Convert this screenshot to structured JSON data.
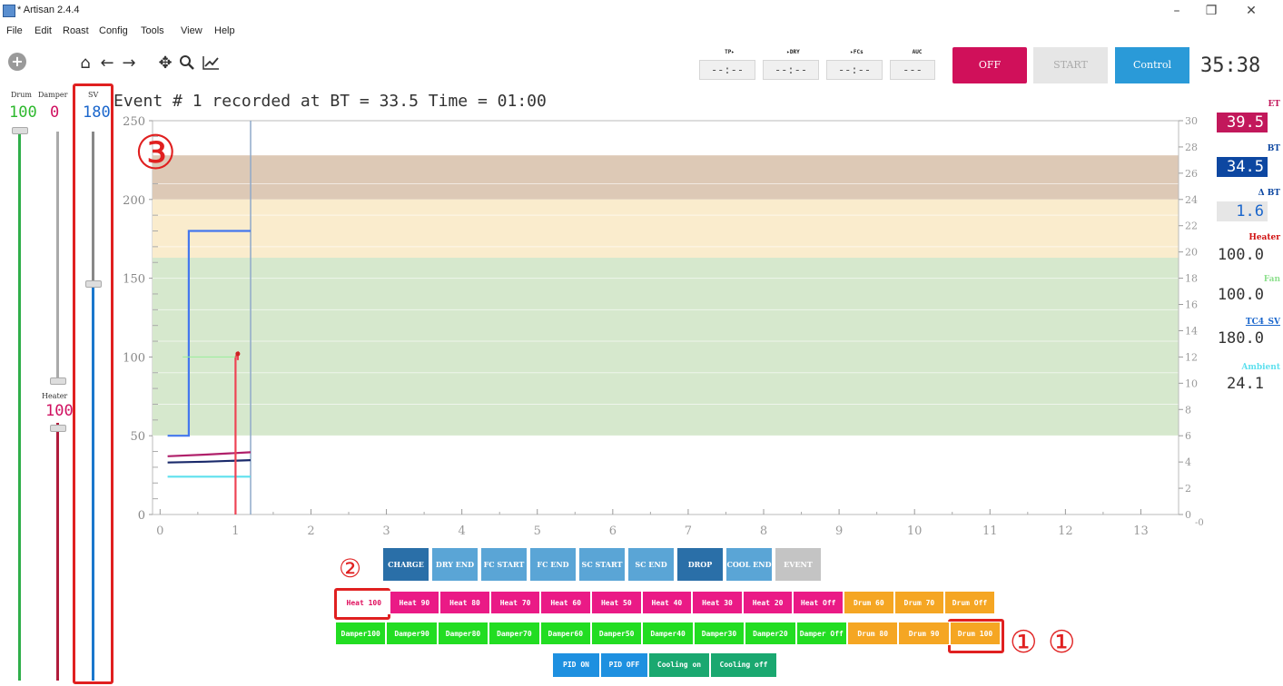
{
  "window": {
    "title": "* Artisan 2.4.4",
    "minimize": "–",
    "maximize": "❐",
    "close": "✕"
  },
  "menu": [
    "File",
    "Edit",
    "Roast",
    "Config",
    "Tools",
    "View",
    "Help"
  ],
  "toolbar": {
    "lcd_labels": [
      "TP▸",
      "▸DRY",
      "▸FCs",
      "AUC"
    ],
    "lcd_values": [
      "--:--",
      "--:--",
      "--:--",
      "---"
    ],
    "off_label": "OFF",
    "start_label": "START",
    "control_label": "Control",
    "timer": "35:38"
  },
  "sliders": {
    "drum": {
      "label": "Drum",
      "value": "100"
    },
    "damper": {
      "label": "Damper",
      "value": "0"
    },
    "sv": {
      "label": "SV",
      "value": "180"
    },
    "heater": {
      "label": "Heater",
      "value": "100"
    }
  },
  "event_message": "Event # 1 recorded at BT = 33.5  Time = 01:00",
  "readouts": {
    "et": {
      "label": "ET",
      "value": "39.5",
      "color": "#c2185b"
    },
    "bt": {
      "label": "BT",
      "value": "34.5",
      "color": "#0d47a1"
    },
    "delta_bt": {
      "label": "Δ BT",
      "value": "1.6"
    },
    "heater": {
      "label": "Heater",
      "value": "100.0"
    },
    "fan": {
      "label": "Fan",
      "value": "100.0"
    },
    "tc4_sv": {
      "label": "TC4_SV",
      "value": "180.0"
    },
    "ambient": {
      "label": "Ambient",
      "value": "24.1"
    }
  },
  "chart_data": {
    "type": "line",
    "xlabel": "",
    "ylabel": "",
    "xlim": [
      -0.1,
      13.5
    ],
    "ylim": [
      0,
      250
    ],
    "x_ticks": [
      "0",
      "1",
      "2",
      "3",
      "4",
      "5",
      "6",
      "7",
      "8",
      "9",
      "10",
      "11",
      "12",
      "13"
    ],
    "y_ticks": [
      "0",
      "50",
      "100",
      "150",
      "200",
      "250"
    ],
    "y2lim": [
      0,
      30
    ],
    "y2_ticks": [
      "0",
      "2",
      "4",
      "6",
      "8",
      "10",
      "12",
      "14",
      "16",
      "18",
      "20",
      "22",
      "24",
      "26",
      "28",
      "30"
    ],
    "y2_extra_tick": "-0",
    "bands": [
      {
        "from": 228,
        "to": 200,
        "color": "#ddc9b6"
      },
      {
        "from": 200,
        "to": 163,
        "color": "#faeccd"
      },
      {
        "from": 163,
        "to": 50,
        "color": "#d6e8cd"
      }
    ],
    "event_line_x": 1.2,
    "series": [
      {
        "name": "SV",
        "color": "#4477ee",
        "x": [
          0.1,
          0.38,
          0.38,
          1.2
        ],
        "y": [
          50,
          50,
          180,
          180
        ]
      },
      {
        "name": "ET",
        "color": "#b0206a",
        "x": [
          0.1,
          0.6,
          1.2
        ],
        "y": [
          37,
          38,
          39.5
        ]
      },
      {
        "name": "BT",
        "color": "#1a2a6b",
        "x": [
          0.1,
          0.6,
          1.2
        ],
        "y": [
          33,
          33.5,
          34.5
        ]
      },
      {
        "name": "Ambient",
        "color": "#5ee0ee",
        "x": [
          0.1,
          1.2
        ],
        "y": [
          24,
          24
        ]
      },
      {
        "name": "Heater",
        "color": "#ee4455",
        "x": [
          1.0,
          1.0,
          1.03,
          1.03
        ],
        "y": [
          0,
          100,
          102,
          98
        ]
      },
      {
        "name": "Fan",
        "color": "#99ee99",
        "x": [
          0.3,
          1.0
        ],
        "y": [
          100,
          100
        ]
      }
    ]
  },
  "event_buttons": [
    {
      "label": "CHARGE",
      "color": "#2a6fa8"
    },
    {
      "label": "DRY END",
      "color": "#5aa5d6"
    },
    {
      "label": "FC START",
      "color": "#5aa5d6"
    },
    {
      "label": "FC END",
      "color": "#5aa5d6"
    },
    {
      "label": "SC START",
      "color": "#5aa5d6"
    },
    {
      "label": "SC END",
      "color": "#5aa5d6"
    },
    {
      "label": "DROP",
      "color": "#2a6fa8"
    },
    {
      "label": "COOL END",
      "color": "#5aa5d6"
    },
    {
      "label": "EVENT",
      "color": "#c4c4c4"
    }
  ],
  "custom_row1": [
    {
      "label": "Heat 100",
      "color": "#ffffff",
      "text": "#e0105e"
    },
    {
      "label": "Heat 90",
      "color": "#ea1a86",
      "text": "#ffffff"
    },
    {
      "label": "Heat 80",
      "color": "#ea1a86",
      "text": "#ffffff"
    },
    {
      "label": "Heat 70",
      "color": "#ea1a86",
      "text": "#ffffff"
    },
    {
      "label": "Heat 60",
      "color": "#ea1a86",
      "text": "#ffffff"
    },
    {
      "label": "Heat 50",
      "color": "#ea1a86",
      "text": "#ffffff"
    },
    {
      "label": "Heat 40",
      "color": "#ea1a86",
      "text": "#ffffff"
    },
    {
      "label": "Heat 30",
      "color": "#ea1a86",
      "text": "#ffffff"
    },
    {
      "label": "Heat 20",
      "color": "#ea1a86",
      "text": "#ffffff"
    },
    {
      "label": "Heat Off",
      "color": "#ea1a86",
      "text": "#ffffff"
    },
    {
      "label": "Drum 60",
      "color": "#f5a623",
      "text": "#ffffff"
    },
    {
      "label": "Drum 70",
      "color": "#f5a623",
      "text": "#ffffff"
    },
    {
      "label": "Drum Off",
      "color": "#f5a623",
      "text": "#ffffff"
    }
  ],
  "custom_row2": [
    {
      "label": "Damper100",
      "color": "#22dd22"
    },
    {
      "label": "Damper90",
      "color": "#22dd22"
    },
    {
      "label": "Damper80",
      "color": "#22dd22"
    },
    {
      "label": "Damper70",
      "color": "#22dd22"
    },
    {
      "label": "Damper60",
      "color": "#22dd22"
    },
    {
      "label": "Damper50",
      "color": "#22dd22"
    },
    {
      "label": "Damper40",
      "color": "#22dd22"
    },
    {
      "label": "Damper30",
      "color": "#22dd22"
    },
    {
      "label": "Damper20",
      "color": "#22dd22"
    },
    {
      "label": "Damper Off",
      "color": "#22dd22"
    },
    {
      "label": "Drum 80",
      "color": "#f5a623"
    },
    {
      "label": "Drum 90",
      "color": "#f5a623"
    },
    {
      "label": "Drum 100",
      "color": "#f5a623"
    }
  ],
  "custom_row3": [
    {
      "label": "PID ON",
      "color": "#1e90e0"
    },
    {
      "label": "PID OFF",
      "color": "#1e90e0"
    },
    {
      "label": "Cooling on",
      "color": "#1aa870"
    },
    {
      "label": "Cooling off",
      "color": "#1aa870"
    }
  ],
  "annotations": {
    "m1": "①",
    "m1b": "①",
    "m2": "②",
    "m3": "③"
  }
}
